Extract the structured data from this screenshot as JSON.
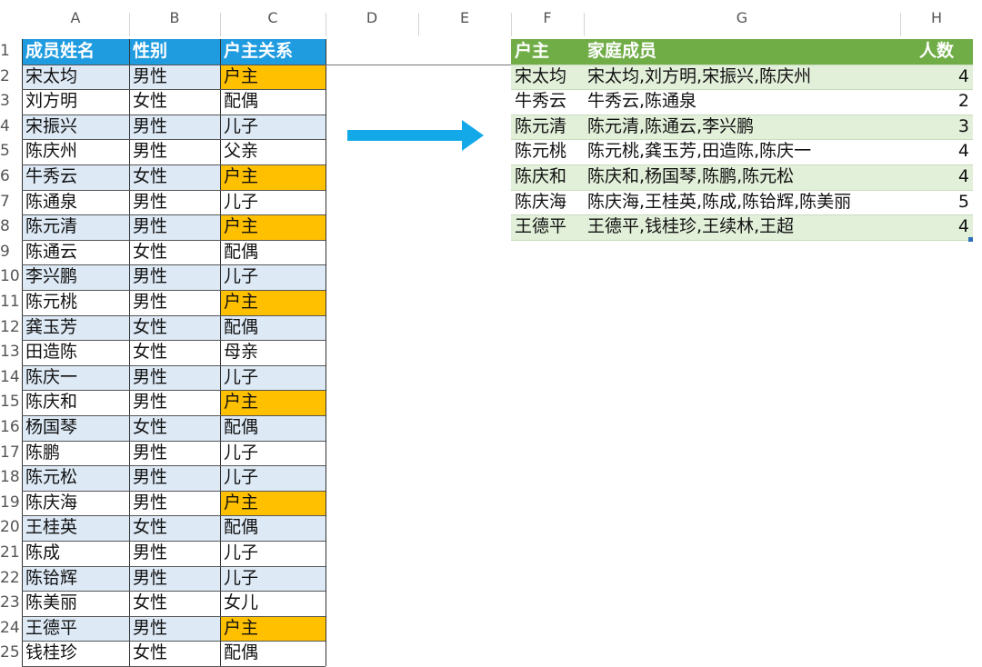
{
  "column_headers": [
    "A",
    "B",
    "C",
    "D",
    "E",
    "F",
    "G",
    "H"
  ],
  "row_numbers": [
    "1",
    "2",
    "3",
    "4",
    "5",
    "6",
    "7",
    "8",
    "9",
    "10",
    "11",
    "12",
    "13",
    "14",
    "15",
    "16",
    "17",
    "18",
    "19",
    "20",
    "21",
    "22",
    "23",
    "24",
    "25"
  ],
  "left_table": {
    "headers": [
      "成员姓名",
      "性别",
      "户主关系"
    ],
    "rows": [
      [
        "宋太均",
        "男性",
        "户主"
      ],
      [
        "刘方明",
        "女性",
        "配偶"
      ],
      [
        "宋振兴",
        "男性",
        "儿子"
      ],
      [
        "陈庆州",
        "男性",
        "父亲"
      ],
      [
        "牛秀云",
        "女性",
        "户主"
      ],
      [
        "陈通泉",
        "男性",
        "儿子"
      ],
      [
        "陈元清",
        "男性",
        "户主"
      ],
      [
        "陈通云",
        "女性",
        "配偶"
      ],
      [
        "李兴鹏",
        "男性",
        "儿子"
      ],
      [
        "陈元桃",
        "男性",
        "户主"
      ],
      [
        "龚玉芳",
        "女性",
        "配偶"
      ],
      [
        "田造陈",
        "女性",
        "母亲"
      ],
      [
        "陈庆一",
        "男性",
        "儿子"
      ],
      [
        "陈庆和",
        "男性",
        "户主"
      ],
      [
        "杨国琴",
        "女性",
        "配偶"
      ],
      [
        "陈鹏",
        "男性",
        "儿子"
      ],
      [
        "陈元松",
        "男性",
        "儿子"
      ],
      [
        "陈庆海",
        "男性",
        "户主"
      ],
      [
        "王桂英",
        "女性",
        "配偶"
      ],
      [
        "陈成",
        "男性",
        "儿子"
      ],
      [
        "陈铪辉",
        "男性",
        "儿子"
      ],
      [
        "陈美丽",
        "女性",
        "女儿"
      ],
      [
        "王德平",
        "男性",
        "户主"
      ],
      [
        "钱桂珍",
        "女性",
        "配偶"
      ]
    ]
  },
  "right_table": {
    "headers": [
      "户主",
      "家庭成员",
      "人数"
    ],
    "rows": [
      [
        "宋太均",
        "宋太均,刘方明,宋振兴,陈庆州",
        "4"
      ],
      [
        "牛秀云",
        "牛秀云,陈通泉",
        "2"
      ],
      [
        "陈元清",
        "陈元清,陈通云,李兴鹏",
        "3"
      ],
      [
        "陈元桃",
        "陈元桃,龚玉芳,田造陈,陈庆一",
        "4"
      ],
      [
        "陈庆和",
        "陈庆和,杨国琴,陈鹏,陈元松",
        "4"
      ],
      [
        "陈庆海",
        "陈庆海,王桂英,陈成,陈铪辉,陈美丽",
        "5"
      ],
      [
        "王德平",
        "王德平,钱桂珍,王续林,王超",
        "4"
      ]
    ]
  },
  "colors": {
    "header_blue": "#1f9be0",
    "row_blue": "#dde9f5",
    "householder_orange": "#ffc000",
    "header_green": "#70ad47",
    "row_green": "#e2efd9",
    "arrow_blue": "#13a9e8"
  },
  "icons": {
    "arrow": "right-arrow-icon"
  }
}
